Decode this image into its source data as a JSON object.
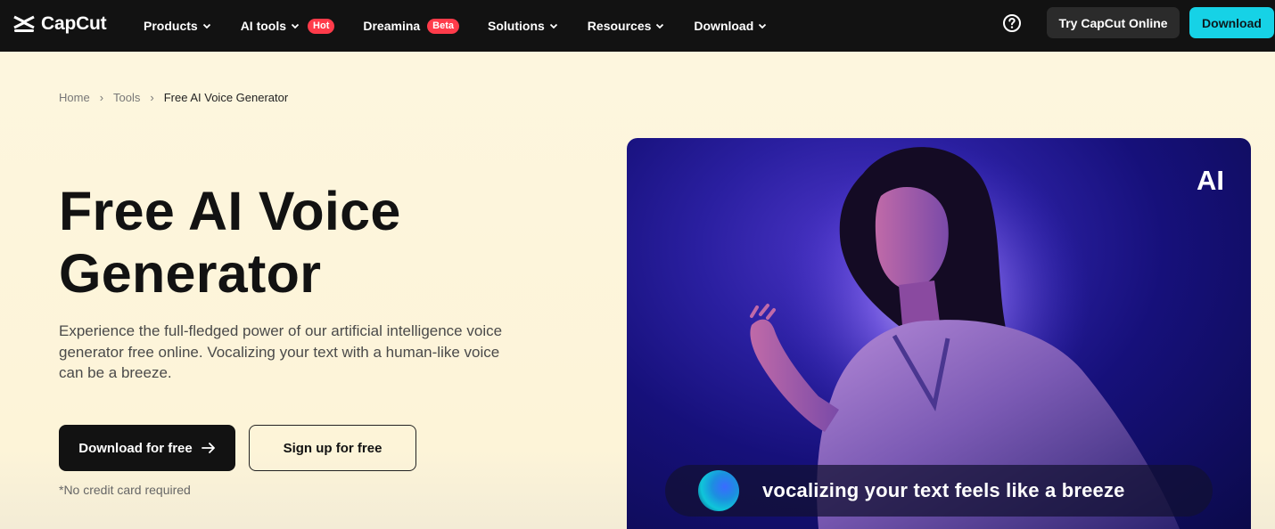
{
  "nav": {
    "logo_text": "CapCut",
    "items": [
      {
        "label": "Products",
        "has_dropdown": true
      },
      {
        "label": "AI tools",
        "has_dropdown": true,
        "badge": "Hot"
      },
      {
        "label": "Dreamina",
        "has_dropdown": false,
        "badge": "Beta"
      },
      {
        "label": "Solutions",
        "has_dropdown": true
      },
      {
        "label": "Resources",
        "has_dropdown": true
      },
      {
        "label": "Download",
        "has_dropdown": true
      }
    ],
    "try_online_label": "Try CapCut Online",
    "download_label": "Download",
    "help_icon": "question-circle-icon"
  },
  "breadcrumb": {
    "items": [
      "Home",
      "Tools",
      "Free AI Voice Generator"
    ]
  },
  "hero": {
    "title_line1": "Free AI Voice",
    "title_line2": "Generator",
    "description": "Experience the full-fledged power of our artificial intelligence voice generator free online. Vocalizing your text with a human-like voice can be a breeze.",
    "download_label": "Download for free",
    "signup_label": "Sign up for free",
    "note": "*No credit card required",
    "image": {
      "ai_label": "AI",
      "caption": "vocalizing your text feels like a breeze"
    }
  },
  "colors": {
    "nav_bg": "#121212",
    "accent_cyan": "#16d2e6",
    "badge_red": "#ff3b4a",
    "page_bg": "#fdf6df",
    "hero_bg": "#2a1fa0"
  }
}
